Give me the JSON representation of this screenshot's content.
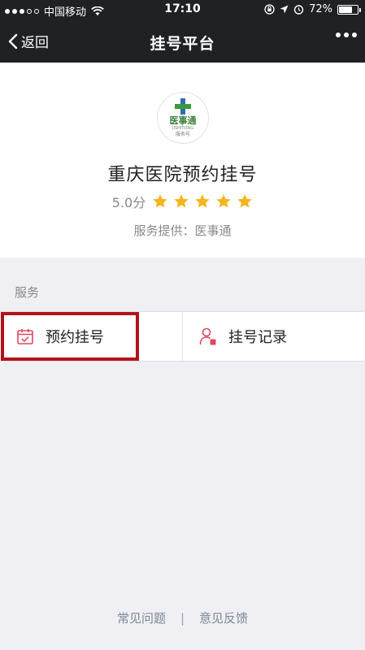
{
  "status": {
    "carrier": "中国移动",
    "time": "17:10",
    "battery": "72%",
    "battery_level": 0.72
  },
  "nav": {
    "back_label": "返回",
    "title": "挂号平台"
  },
  "profile": {
    "logo_line1": "医事通",
    "logo_line2": "JISHITONG",
    "logo_line3": "服务号",
    "name": "重庆医院预约挂号",
    "score": "5.0分",
    "stars": 5,
    "provider": "服务提供：医事通"
  },
  "services": {
    "section_label": "服务",
    "items": [
      {
        "label": "预约挂号",
        "icon": "calendar-icon"
      },
      {
        "label": "挂号记录",
        "icon": "user-record-icon"
      }
    ]
  },
  "footer": {
    "faq": "常见问题",
    "separator": "|",
    "feedback": "意见反馈"
  },
  "colors": {
    "nav_bg": "#1f2125",
    "star": "#f5b51b",
    "icon": "#e0475e",
    "highlight": "#b3121b",
    "link": "#7b8796"
  }
}
